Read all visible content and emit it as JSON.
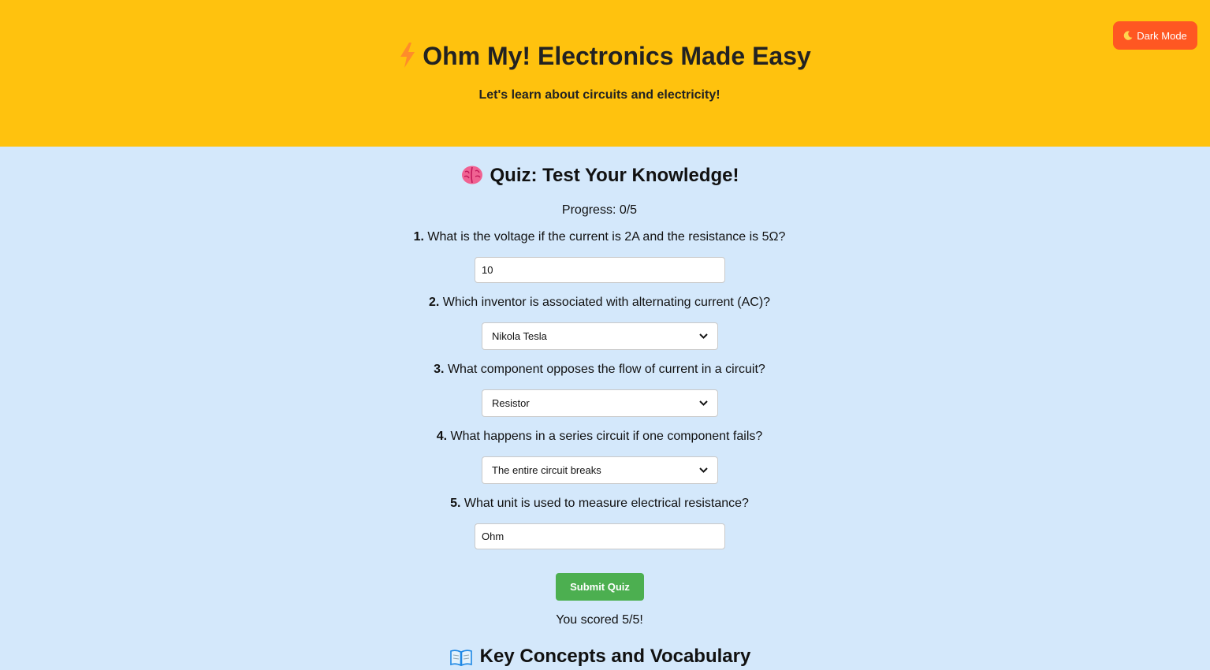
{
  "header": {
    "title": "Ohm My! Electronics Made Easy",
    "title_icon": "lightning-bolt-icon",
    "subtitle": "Let's learn about circuits and electricity!",
    "background_color": "#ffc20e",
    "dark_mode_button": {
      "label": "Dark Mode",
      "icon": "moon-icon",
      "color": "#ff5722"
    }
  },
  "quiz": {
    "title": "Quiz: Test Your Knowledge!",
    "title_icon": "brain-icon",
    "progress": "Progress: 0/5",
    "questions": [
      {
        "number": "1.",
        "text": "What is the voltage if the current is 2A and the resistance is 5Ω?",
        "type": "text",
        "value": "10"
      },
      {
        "number": "2.",
        "text": "Which inventor is associated with alternating current (AC)?",
        "type": "select",
        "value": "Nikola Tesla"
      },
      {
        "number": "3.",
        "text": "What component opposes the flow of current in a circuit?",
        "type": "select",
        "value": "Resistor"
      },
      {
        "number": "4.",
        "text": "What happens in a series circuit if one component fails?",
        "type": "select",
        "value": "The entire circuit breaks"
      },
      {
        "number": "5.",
        "text": "What unit is used to measure electrical resistance?",
        "type": "text",
        "value": "Ohm"
      }
    ],
    "submit_label": "Submit Quiz",
    "submit_color": "#4caf50",
    "score": "You scored 5/5!"
  },
  "concepts": {
    "title": "Key Concepts and Vocabulary",
    "title_icon": "open-book-icon"
  },
  "page_background": "#d4e8fb"
}
